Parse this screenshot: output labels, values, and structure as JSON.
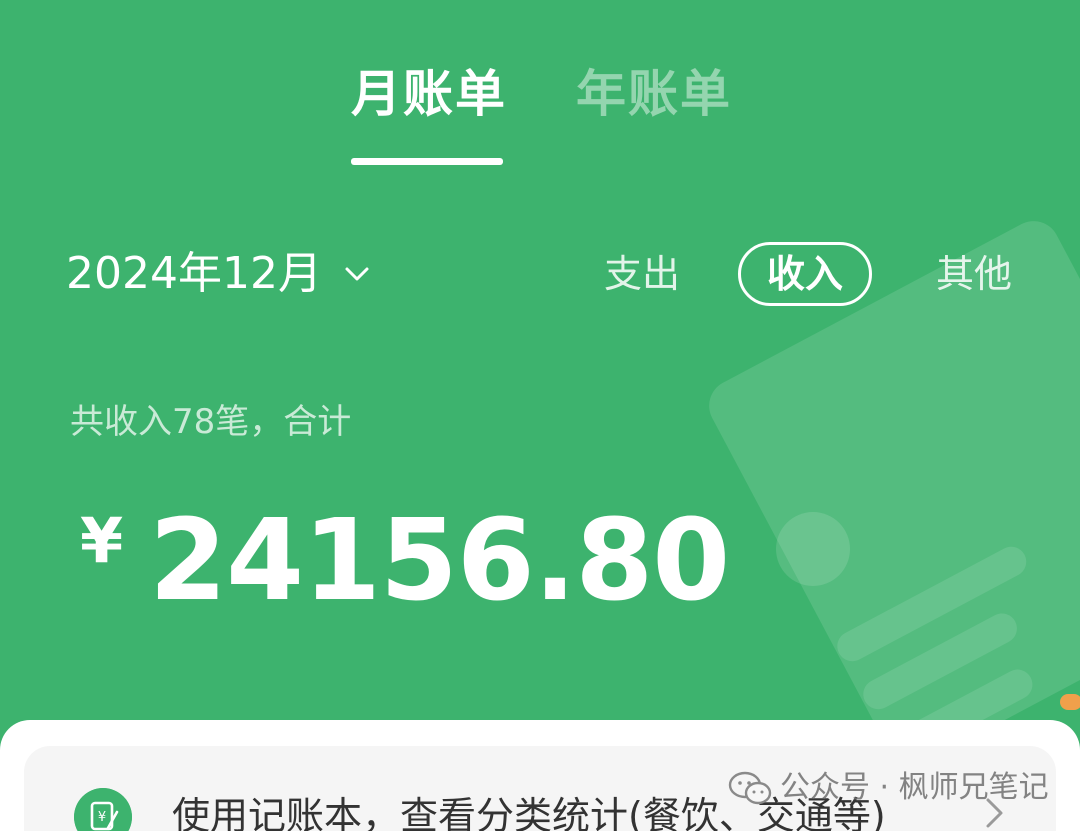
{
  "tabs": [
    {
      "label": "月账单",
      "active": true
    },
    {
      "label": "年账单",
      "active": false
    }
  ],
  "date_selector": {
    "label": "2024年12月",
    "icon": "chevron-down-icon"
  },
  "filters": [
    {
      "label": "支出",
      "selected": false
    },
    {
      "label": "收入",
      "selected": true
    },
    {
      "label": "其他",
      "selected": false
    }
  ],
  "summary": {
    "text": "共收入78笔，合计",
    "currency": "¥",
    "amount": "24156.80"
  },
  "promo": {
    "text": "使用记账本，查看分类统计(餐饮、交通等)",
    "icon": "ledger-icon"
  },
  "watermark": {
    "text": "公众号 · 枫师兄笔记",
    "icon": "wechat-icon"
  },
  "colors": {
    "background": "#3DB36E",
    "sheet": "#FFFFFF",
    "accent_dot": "#F0A04B"
  }
}
